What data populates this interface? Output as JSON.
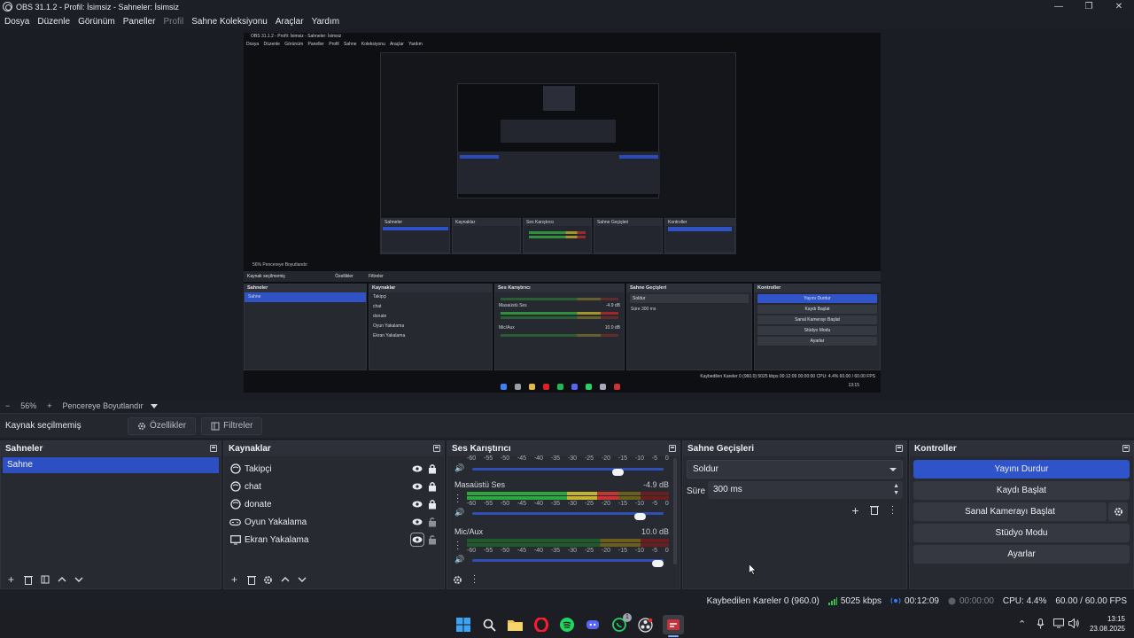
{
  "window": {
    "title": "OBS 31.1.2 - Profil: İsimsiz - Sahneler: İsimsiz",
    "controls": [
      "minimize",
      "restore",
      "close"
    ]
  },
  "menu": [
    "Dosya",
    "Düzenle",
    "Görünüm",
    "Paneller",
    "Profil",
    "Sahne Koleksiyonu",
    "Araçlar",
    "Yardım"
  ],
  "preview": {
    "nested": {
      "title": "OBS 31.1.2 - Profil: İsimsiz - Sahneler: İsimsiz",
      "menu": "Dosya Düzenle Görünüm Paneller Profil Sahne Koleksiyonu Araçlar Yardım",
      "zoom": "56%   Pencereye Boyutlandır",
      "no_source": "Kaynak seçilmemiş",
      "props": "Özellikler",
      "filters": "Filtreler",
      "docks": {
        "scenes": "Sahneler",
        "sources": "Kaynaklar",
        "mixer": "Ses Karıştırıcı",
        "transitions": "Sahne Geçişleri",
        "controls": "Kontroller"
      },
      "scene_item": "Sahne",
      "source_items": [
        "Takipçi",
        "chat",
        "donate",
        "Oyun Yakalama",
        "Ekran Yakalama"
      ],
      "mixer_tracks": [
        "Masaüstü Ses",
        "Mic/Aux"
      ],
      "mixer_db": [
        "-4.9 dB",
        "10.0 dB"
      ],
      "transition": "Soldur",
      "duration_label": "Süre",
      "duration": "300 ms",
      "controls_buttons": [
        "Yayını Durdur",
        "Kaydı Başlat",
        "Sanal Kamerayı Başlat",
        "Stüdyo Modu",
        "Ayarlar"
      ],
      "status": "Kaybedilen Kareler 0 (960.0)   5025 kbps   00:12:09   00:00:00   CPU: 4.4%   60.00 / 60.00 FPS",
      "clock": "13:15"
    }
  },
  "zoom": {
    "minus": "−",
    "value": "56%",
    "plus": "+",
    "fit": "Pencereye Boyutlandır"
  },
  "source_toolbar": {
    "no_source": "Kaynak seçilmemiş",
    "properties": "Özellikler",
    "filters": "Filtreler"
  },
  "scenes": {
    "title": "Sahneler",
    "items": [
      "Sahne"
    ]
  },
  "sources": {
    "title": "Kaynaklar",
    "items": [
      "Takipçi",
      "chat",
      "donate",
      "Oyun Yakalama",
      "Ekran Yakalama"
    ]
  },
  "mixer": {
    "title": "Ses Karıştırıcı",
    "ticks": [
      "-60",
      "-55",
      "-50",
      "-45",
      "-40",
      "-35",
      "-30",
      "-25",
      "-20",
      "-15",
      "-10",
      "-5",
      "0"
    ],
    "tracks": [
      {
        "name": "",
        "db": "",
        "level": 0.0,
        "volume": 0.78
      },
      {
        "name": "Masaüstü Ses",
        "db": "-4.9 dB",
        "level": 0.75,
        "volume": 0.9
      },
      {
        "name": "Mic/Aux",
        "db": "10.0 dB",
        "level": 0.0,
        "volume": 1.0
      }
    ]
  },
  "transitions": {
    "title": "Sahne Geçişleri",
    "selected": "Soldur",
    "duration_label": "Süre",
    "duration": "300 ms"
  },
  "controls": {
    "title": "Kontroller",
    "stream": "Yayını Durdur",
    "record": "Kaydı Başlat",
    "virtualcam": "Sanal Kamerayı Başlat",
    "studio": "Stüdyo Modu",
    "settings": "Ayarlar"
  },
  "status": {
    "dropped": "Kaybedilen Kareler 0 (960.0)",
    "bitrate": "5025 kbps",
    "stream_time": "00:12:09",
    "record_time": "00:00:00",
    "cpu": "CPU: 4.4%",
    "fps": "60.00 / 60.00 FPS"
  },
  "taskbar": {
    "time": "13:15",
    "date": "23.08.2025",
    "whatsapp_badge": "1"
  },
  "colors": {
    "accent": "#2f53c9",
    "background": "#1d1f26",
    "dock": "#272a31"
  }
}
